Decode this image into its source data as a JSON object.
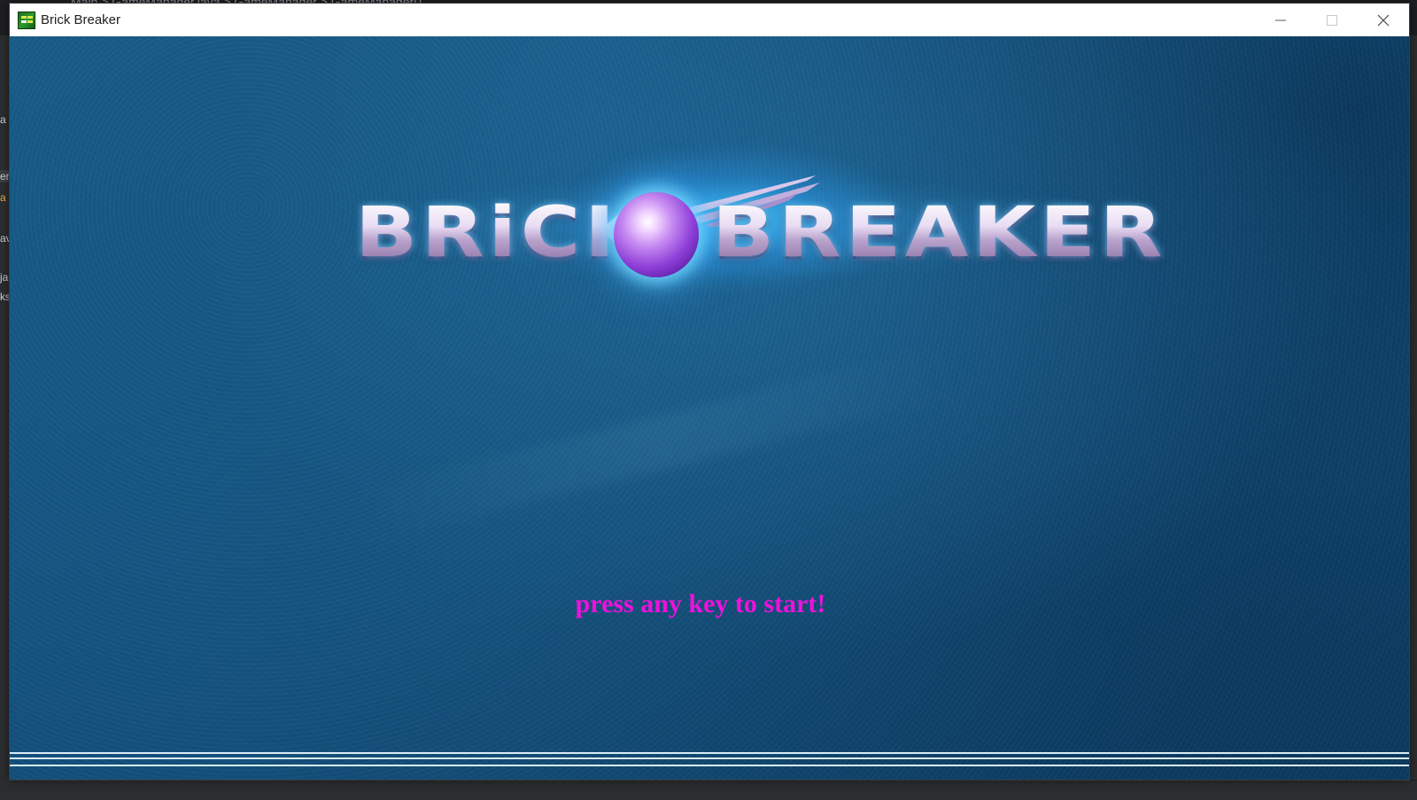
{
  "window": {
    "title": "Brick Breaker",
    "controls": {
      "minimize": "minimize-icon",
      "maximize": "maximize-icon",
      "close": "close-icon"
    }
  },
  "background_ide": {
    "breadcrumb": "Main  >  GameManager.java  >  GameManager  >  GameManager()",
    "sidebar_fragments": [
      "a",
      "er.",
      "a",
      "av",
      "ja",
      "ks."
    ]
  },
  "game": {
    "logo": {
      "word_left": "BRiCK",
      "word_right": "BREAKER"
    },
    "start_prompt": "press any key to start!",
    "colors": {
      "prompt": "#ee11dd",
      "background": "#13527e",
      "track_lines": "#d9ecf5"
    }
  }
}
